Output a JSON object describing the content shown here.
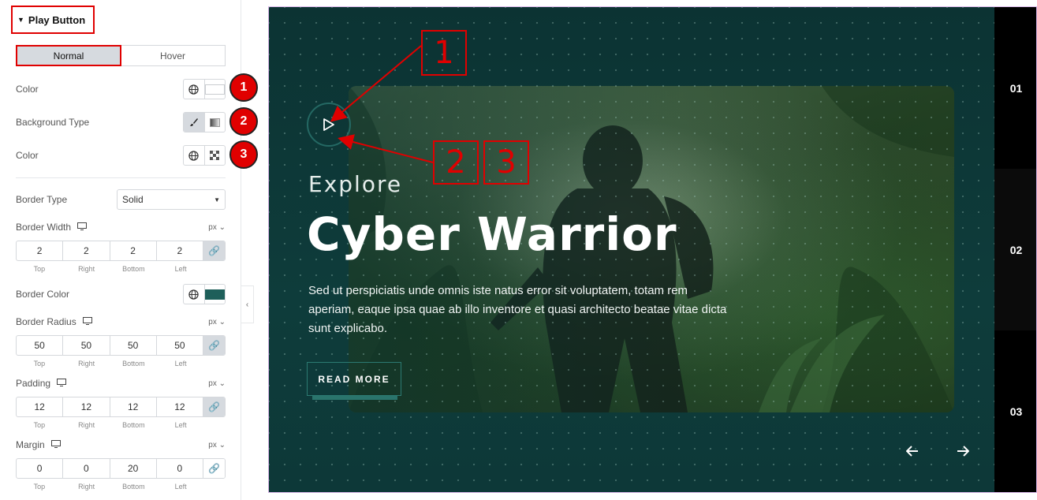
{
  "panel": {
    "section_title": "Play Button",
    "tabs": [
      {
        "label": "Normal"
      },
      {
        "label": "Hover"
      }
    ],
    "color_label": "Color",
    "background_type_label": "Background Type",
    "color2_label": "Color",
    "border_type_label": "Border Type",
    "border_type_value": "Solid",
    "border_width_label": "Border Width",
    "border_width_unit": "px",
    "border_width": [
      "2",
      "2",
      "2",
      "2"
    ],
    "dim_labels": [
      "Top",
      "Right",
      "Bottom",
      "Left"
    ],
    "border_color_label": "Border Color",
    "border_color": "#1e5f5a",
    "border_radius_label": "Border Radius",
    "border_radius_unit": "px",
    "border_radius": [
      "50",
      "50",
      "50",
      "50"
    ],
    "padding_label": "Padding",
    "padding_unit": "px",
    "padding": [
      "12",
      "12",
      "12",
      "12"
    ],
    "margin_label": "Margin",
    "margin_unit": "px",
    "margin": [
      "0",
      "0",
      "20",
      "0"
    ],
    "badges": [
      "1",
      "2",
      "3"
    ]
  },
  "slide": {
    "eyebrow": "Explore",
    "title": "Cyber Warrior",
    "description": "Sed ut perspiciatis unde omnis iste natus error sit voluptatem, totam rem aperiam, eaque ipsa quae ab illo inventore et quasi architecto beatae vitae dicta sunt explicabo.",
    "button_label": "READ MORE",
    "nav_numbers": [
      "01",
      "02",
      "03"
    ]
  },
  "annotations": [
    "1",
    "2",
    "3"
  ],
  "colors": {
    "accent": "#e00000",
    "teal": "#1e5f5a",
    "bg": "#0d3a3a"
  }
}
